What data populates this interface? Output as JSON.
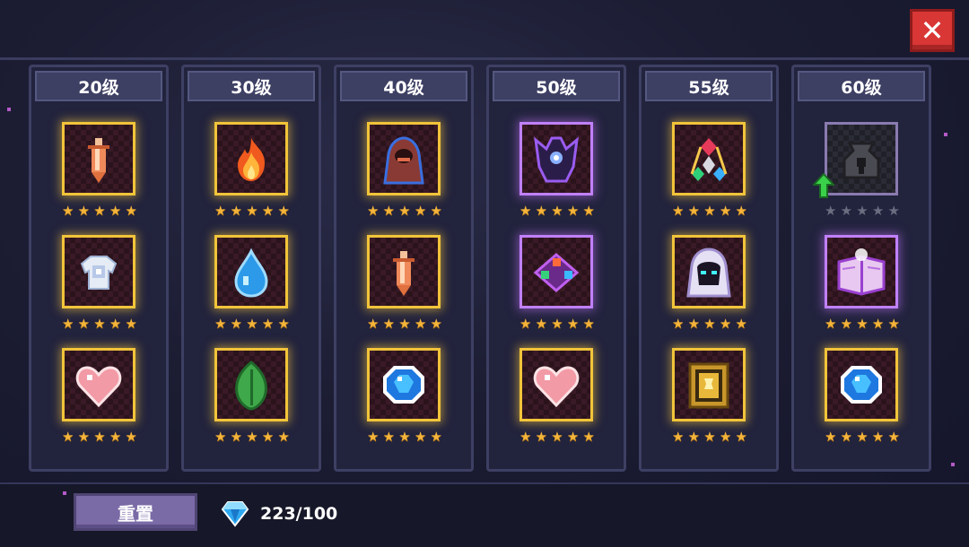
{
  "close_button": {
    "label": "✕"
  },
  "columns": [
    {
      "level": "20级",
      "rows": [
        {
          "icon": "sword-icon",
          "stars": 5
        },
        {
          "icon": "armor-icon",
          "stars": 5
        },
        {
          "icon": "heart-icon",
          "stars": 5
        }
      ]
    },
    {
      "level": "30级",
      "rows": [
        {
          "icon": "fire-icon",
          "stars": 5
        },
        {
          "icon": "water-drop-icon",
          "stars": 5
        },
        {
          "icon": "leaf-icon",
          "stars": 5
        }
      ]
    },
    {
      "level": "40级",
      "rows": [
        {
          "icon": "hooded-figure-icon",
          "stars": 5
        },
        {
          "icon": "sword-icon",
          "stars": 5
        },
        {
          "icon": "blue-gem-icon",
          "stars": 5
        }
      ]
    },
    {
      "level": "50级",
      "rows": [
        {
          "icon": "shadow-demon-icon",
          "stars": 5
        },
        {
          "icon": "gem-triad-icon",
          "stars": 5
        },
        {
          "icon": "heart-icon",
          "stars": 5
        }
      ]
    },
    {
      "level": "55级",
      "rows": [
        {
          "icon": "gem-pyramid-icon",
          "stars": 5
        },
        {
          "icon": "white-hood-icon",
          "stars": 5
        },
        {
          "icon": "golden-book-icon",
          "stars": 5
        }
      ]
    },
    {
      "level": "60级",
      "rows": [
        {
          "icon": "locked-pot-icon",
          "stars": 0,
          "upgrade": true
        },
        {
          "icon": "magic-book-icon",
          "stars": 5
        },
        {
          "icon": "blue-gem-icon",
          "stars": 5
        }
      ]
    }
  ],
  "footer": {
    "reset_label": "重置",
    "gems": "223/100"
  },
  "colors": {
    "star": "#f4b43a",
    "frame": "#f1c43a",
    "close": "#d93636",
    "reset": "#7a6aa6"
  }
}
